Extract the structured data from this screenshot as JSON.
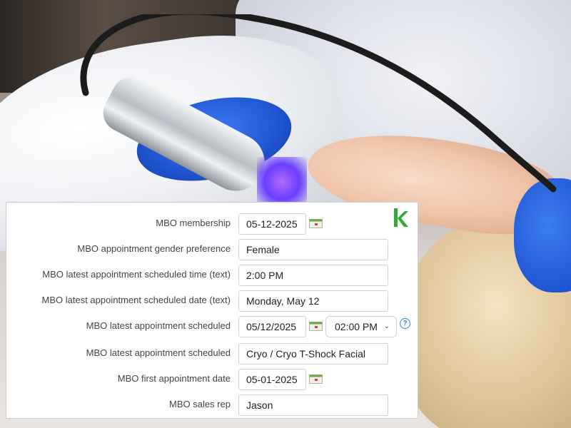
{
  "form": {
    "fields": [
      {
        "label": "MBO membership",
        "value": "05-12-2025",
        "type": "date"
      },
      {
        "label": "MBO appointment gender preference",
        "value": "Female",
        "type": "text"
      },
      {
        "label": "MBO latest appointment scheduled time (text)",
        "value": "2:00 PM",
        "type": "text"
      },
      {
        "label": "MBO latest appointment scheduled date (text)",
        "value": "Monday, May 12",
        "type": "text"
      },
      {
        "label": "MBO latest appointment scheduled",
        "value": "05/12/2025",
        "type": "datetime",
        "time_value": "02:00 PM"
      },
      {
        "label": "MBO latest appointment scheduled",
        "value": "Cryo / Cryo T-Shock Facial",
        "type": "text"
      },
      {
        "label": "MBO first appointment date",
        "value": "05-01-2025",
        "type": "date"
      },
      {
        "label": "MBO sales rep",
        "value": "Jason",
        "type": "text"
      }
    ]
  },
  "icons": {
    "calendar": "calendar-icon",
    "help": "help-icon",
    "chevron": "chevron-down-icon",
    "logo": "keap-logo-icon",
    "help_glyph": "?",
    "chevron_glyph": "⌄"
  },
  "colors": {
    "logo_green": "#36a635",
    "help_blue": "#3a7fd1",
    "glove_blue": "#1f55d2"
  }
}
